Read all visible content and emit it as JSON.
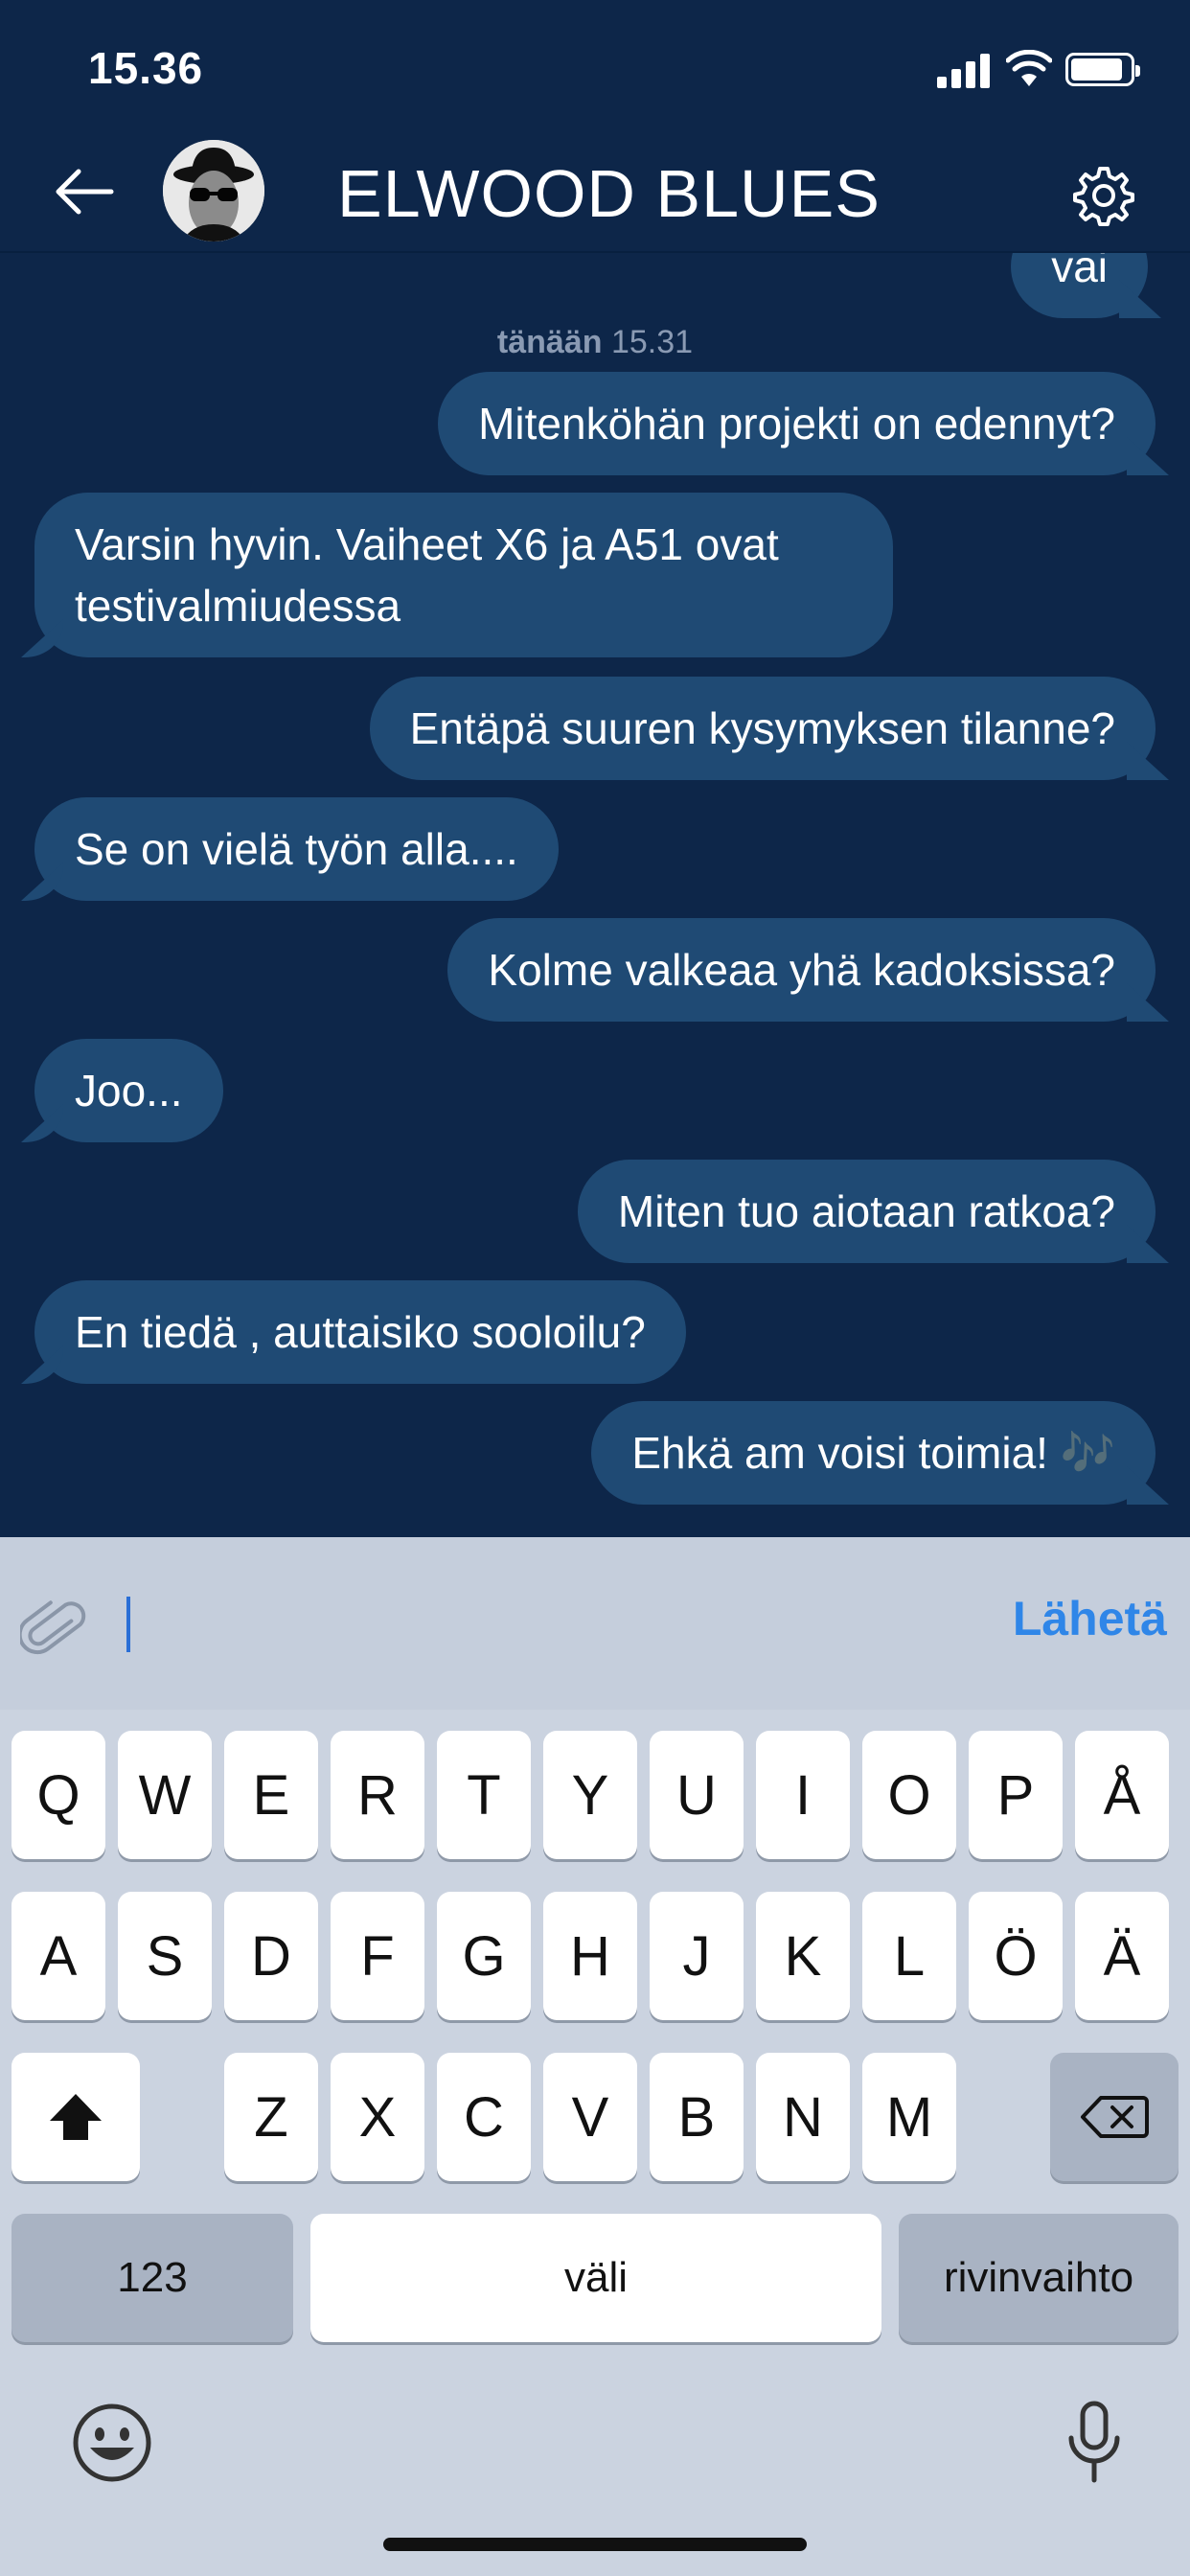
{
  "status_bar": {
    "time": "15.36"
  },
  "header": {
    "contact_name": "ELWOOD BLUES"
  },
  "conversation": {
    "partial_top": "vai",
    "timestamp_day": "tänään",
    "timestamp_time": "15.31",
    "messages": [
      {
        "direction": "out",
        "text": "Mitenköhän projekti on edennyt?"
      },
      {
        "direction": "in",
        "text": "Varsin hyvin. Vaiheet X6 ja A51 ovat testivalmiudessa"
      },
      {
        "direction": "out",
        "text": "Entäpä suuren kysymyksen tilanne?"
      },
      {
        "direction": "in",
        "text": "Se on vielä työn alla...."
      },
      {
        "direction": "out",
        "text": "Kolme valkeaa yhä kadoksissa?"
      },
      {
        "direction": "in",
        "text": "Joo..."
      },
      {
        "direction": "out",
        "text": "Miten tuo aiotaan ratkoa?"
      },
      {
        "direction": "in",
        "text": "En tiedä , auttaisiko sooloilu?"
      },
      {
        "direction": "out",
        "text": "Ehkä am voisi toimia! 🎶"
      }
    ]
  },
  "composer": {
    "placeholder": "",
    "send_label": "Lähetä"
  },
  "keyboard": {
    "row1": [
      "Q",
      "W",
      "E",
      "R",
      "T",
      "Y",
      "U",
      "I",
      "O",
      "P",
      "Å"
    ],
    "row2": [
      "A",
      "S",
      "D",
      "F",
      "G",
      "H",
      "J",
      "K",
      "L",
      "Ö",
      "Ä"
    ],
    "row3": [
      "Z",
      "X",
      "C",
      "V",
      "B",
      "N",
      "M"
    ],
    "numbers_label": "123",
    "space_label": "väli",
    "return_label": "rivinvaihto"
  },
  "colors": {
    "background": "#0d2649",
    "bubble": "#1f4a74",
    "accent": "#2f86e8"
  }
}
